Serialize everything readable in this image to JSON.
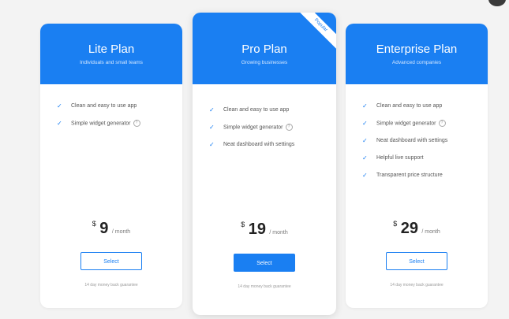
{
  "accent_color": "#1a7ff2",
  "plans": [
    {
      "name": "Lite Plan",
      "subtitle": "Individuals and small teams",
      "features": [
        {
          "text": "Clean and easy to use app",
          "help": false
        },
        {
          "text": "Simple widget generator",
          "help": true
        }
      ],
      "currency": "$",
      "price": "9",
      "period": "/ month",
      "button_label": "Select",
      "guarantee": "14 day money back guarantee"
    },
    {
      "name": "Pro Plan",
      "subtitle": "Growing businesses",
      "ribbon": "Popular",
      "features": [
        {
          "text": "Clean and easy to use app",
          "help": false
        },
        {
          "text": "Simple widget generator",
          "help": true
        },
        {
          "text": "Neat dashboard with settings",
          "help": false
        }
      ],
      "currency": "$",
      "price": "19",
      "period": "/ month",
      "button_label": "Select",
      "guarantee": "14 day money back guarantee"
    },
    {
      "name": "Enterprise Plan",
      "subtitle": "Advanced companies",
      "features": [
        {
          "text": "Clean and easy to use app",
          "help": false
        },
        {
          "text": "Simple widget generator",
          "help": true
        },
        {
          "text": "Neat dashboard with settings",
          "help": false
        },
        {
          "text": "Helpful live support",
          "help": false
        },
        {
          "text": "Transparent price structure",
          "help": false
        }
      ],
      "currency": "$",
      "price": "29",
      "period": "/ month",
      "button_label": "Select",
      "guarantee": "14 day money back guarantee"
    }
  ],
  "icons": {
    "check": "check-icon",
    "help": "help-icon"
  }
}
